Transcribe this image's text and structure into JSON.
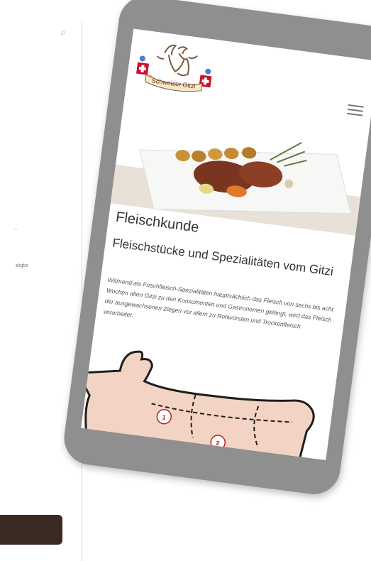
{
  "background_window": {
    "search_icon": "search-icon",
    "snippet": "eigte"
  },
  "site": {
    "logo_text": "Schweizer Gitzi",
    "menu_icon": "hamburger-menu-icon"
  },
  "content": {
    "page_title": "Fleischkunde",
    "section_heading": "Fleischstücke und Spezialitäten vom Gitzi",
    "paragraph": "Während als Frischfleisch-Spezialitäten hauptsächlich das Fleisch von sechs bis acht Wochen alten Gitzi zu den Konsumenten und Gastronomen gelangt, wird das Fleisch der ausgewachsenen Ziegen vor allem zu Rohwürsten und Trockenfleisch verarbeitet."
  },
  "diagram": {
    "cut_labels": [
      "1",
      "2"
    ]
  },
  "colors": {
    "phone_frame": "#8f8f8f",
    "accent_red": "#b62227",
    "goat_fill": "#f3d3c3",
    "button_dark": "#3b2a22"
  }
}
